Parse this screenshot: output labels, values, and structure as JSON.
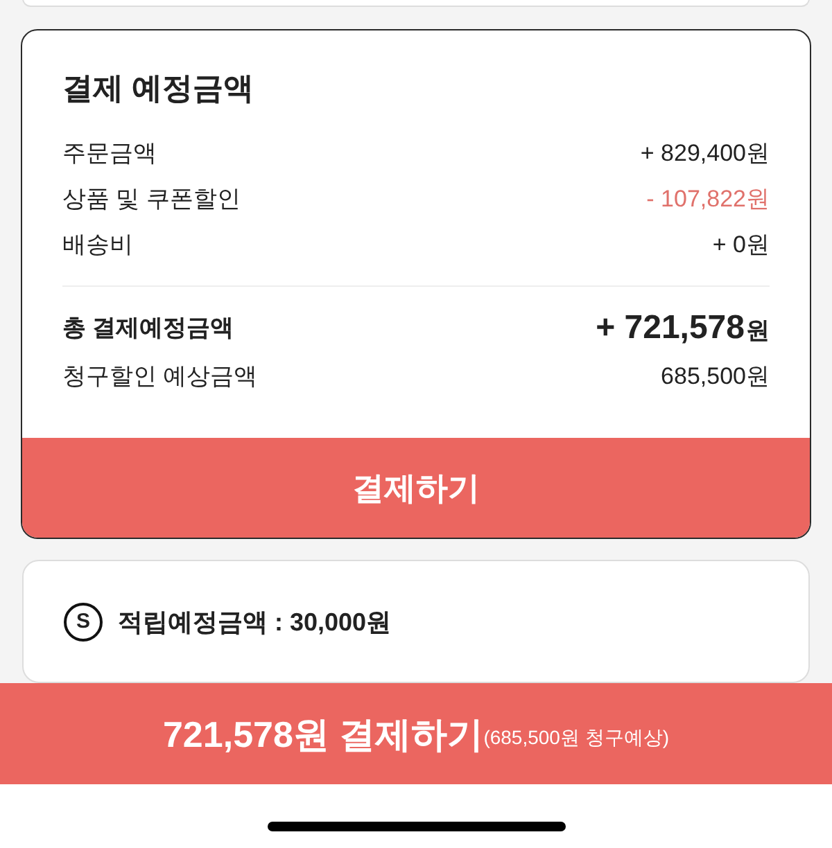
{
  "payment_summary": {
    "title": "결제 예정금액",
    "rows": [
      {
        "label": "주문금액",
        "value": "+ 829,400원",
        "kind": "charge"
      },
      {
        "label": "상품 및 쿠폰할인",
        "value": "- 107,822원",
        "kind": "discount"
      },
      {
        "label": "배송비",
        "value": "+ 0원",
        "kind": "charge"
      }
    ],
    "total": {
      "label": "총 결제예정금액",
      "value": "+ 721,578",
      "unit": "원"
    },
    "billing_discount": {
      "label": "청구할인 예상금액",
      "value": "685,500원"
    },
    "pay_button": "결제하기"
  },
  "points": {
    "icon": "S",
    "label": "적립예정금액 : 30,000원"
  },
  "bottom_bar": {
    "label": "721,578원 결제하기",
    "note": "(685,500원 청구예상)"
  }
}
